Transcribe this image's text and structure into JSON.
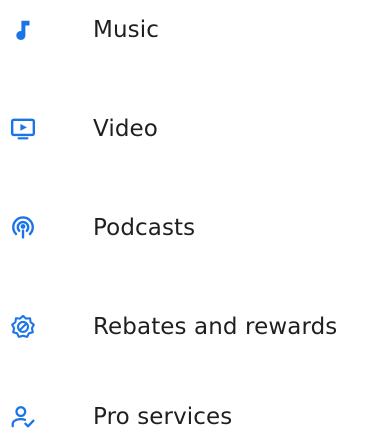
{
  "theme": {
    "accent": "#1a73e8",
    "text": "#1f1f1f",
    "background": "#ffffff"
  },
  "menu": {
    "items": [
      {
        "label": "Music",
        "icon": "music-note-icon"
      },
      {
        "label": "Video",
        "icon": "video-icon"
      },
      {
        "label": "Podcasts",
        "icon": "podcast-icon"
      },
      {
        "label": "Rebates and rewards",
        "icon": "rewards-badge-icon"
      },
      {
        "label": "Pro services",
        "icon": "pro-services-icon"
      }
    ]
  }
}
